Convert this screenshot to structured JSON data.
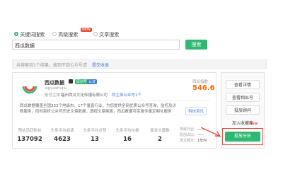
{
  "search_tabs": [
    {
      "label": "关键词搜索",
      "selected": true
    },
    {
      "label": "高级搜索",
      "badge": "NEW",
      "selected": false
    },
    {
      "label": "文章搜索",
      "selected": false
    }
  ],
  "search": {
    "value": "西瓜数据",
    "button": "搜索"
  },
  "result_notice": {
    "text": "共搜索到1个结果，搜到不到公众号请",
    "link": "提交收录"
  },
  "account": {
    "name": "西瓜数据",
    "tags": [
      "原创号",
      "认证"
    ],
    "id": "xiguashujiu",
    "owner_label": "账号主体：",
    "owner": "福州西瓜文化传播有限公司",
    "related_link": "同主体公众号1个",
    "description": "西瓜数据覆盖全国333个地级市、17个垂直行业，为您提供全网优质公众号查询、监控及诊断服务，同时剖析公众号历史文章数据，透视文章画面，西瓜数据可实施专属定制化服务",
    "category": "科技资讯",
    "index_label": "西瓜指数",
    "index_value": "546.6",
    "stats": [
      {
        "label": "预估活跃粉丝",
        "value": "137092"
      },
      {
        "label": "头条平均阅读",
        "value": "4623"
      },
      {
        "label": "头条平均点赞",
        "value": "13"
      },
      {
        "label": "头条平均在看",
        "value": "16"
      },
      {
        "label": "周发文篇数",
        "value": "2"
      }
    ],
    "meta": [
      {
        "label": "所属行业：",
        "value": "——"
      },
      {
        "label": "原创占比：",
        "value": "——"
      },
      {
        "label": "发文频次：",
        "value": "1年内"
      }
    ]
  },
  "side_buttons": [
    "查看详情",
    "查看相似号",
    "投放顾问",
    "加入收藏库"
  ],
  "cta": {
    "label": "投放分析",
    "badge": "New"
  },
  "colors": {
    "green": "#2eb872",
    "accent": "#ff6a00",
    "red": "#e74c3c"
  }
}
